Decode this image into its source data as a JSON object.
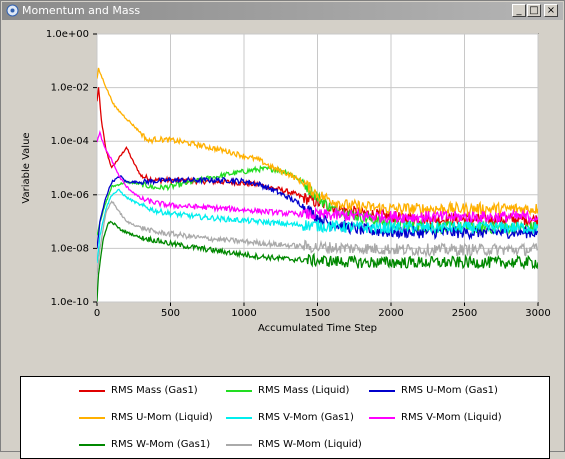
{
  "window": {
    "title": "Momentum and Mass",
    "minimize_glyph": "_",
    "maximize_glyph": "□",
    "close_glyph": "×",
    "icon": "app-gear-icon"
  },
  "chart_data": {
    "type": "line",
    "xlabel": "Accumulated Time Step",
    "ylabel": "Variable Value",
    "yscale": "log",
    "xlim": [
      0,
      3000
    ],
    "ylim": [
      1e-10,
      1
    ],
    "x_ticks": [
      0,
      500,
      1000,
      1500,
      2000,
      2500,
      3000
    ],
    "x_tick_labels": [
      "0",
      "500",
      "1000",
      "1500",
      "2000",
      "2500",
      "3000"
    ],
    "y_ticks": [
      1e-10,
      1e-08,
      1e-06,
      0.0001,
      0.01,
      1
    ],
    "y_tick_labels": [
      "1.0e-10",
      "1.0e-08",
      "1.0e-06",
      "1.0e-04",
      "1.0e-02",
      "1.0e+00"
    ],
    "grid": true,
    "legend_position": "bottom",
    "series": [
      {
        "name": "RMS Mass (Gas1)",
        "color": "#e00000",
        "x": [
          0,
          10,
          30,
          60,
          100,
          140,
          180,
          200,
          240,
          300,
          400,
          500,
          700,
          900,
          1100,
          1300,
          1500,
          1700,
          2000,
          2300,
          2600,
          3000
        ],
        "y": [
          0.003,
          0.01,
          0.0006,
          5e-05,
          1e-05,
          2e-05,
          4e-05,
          6e-05,
          2e-05,
          5e-06,
          3.5e-06,
          3.5e-06,
          3.2e-06,
          3e-06,
          2.4e-06,
          1.3e-06,
          5e-07,
          2.5e-07,
          1.5e-07,
          1.2e-07,
          1.2e-07,
          1.2e-07
        ]
      },
      {
        "name": "RMS Mass (Liquid)",
        "color": "#22dd22",
        "x": [
          0,
          20,
          60,
          100,
          200,
          300,
          400,
          500,
          700,
          900,
          1100,
          1200,
          1300,
          1400,
          1500,
          1600,
          1800,
          2000,
          2300,
          2600,
          3000
        ],
        "y": [
          3e-08,
          1e-07,
          5e-07,
          2e-06,
          3e-06,
          2.5e-06,
          1.8e-06,
          2e-06,
          3.5e-06,
          6e-06,
          9e-06,
          9e-06,
          7e-06,
          3e-06,
          8e-07,
          3e-07,
          1.5e-07,
          8e-08,
          6e-08,
          6e-08,
          6e-08
        ]
      },
      {
        "name": "RMS U-Mom (Gas1)",
        "color": "#0000cc",
        "x": [
          0,
          20,
          60,
          100,
          160,
          200,
          300,
          500,
          700,
          900,
          1000,
          1100,
          1200,
          1300,
          1400,
          1500,
          1600,
          1800,
          2000,
          2300,
          2600,
          3000
        ],
        "y": [
          1e-08,
          1e-07,
          8e-07,
          3e-06,
          5e-06,
          3e-06,
          3e-06,
          3.5e-06,
          3.5e-06,
          3.5e-06,
          3.2e-06,
          2.5e-06,
          1.5e-06,
          8e-07,
          4e-07,
          1.5e-07,
          8e-08,
          5e-08,
          4e-08,
          4e-08,
          4e-08,
          4e-08
        ]
      },
      {
        "name": "RMS U-Mom (Liquid)",
        "color": "#ffb000",
        "x": [
          0,
          10,
          40,
          80,
          120,
          200,
          300,
          350,
          400,
          500,
          600,
          700,
          900,
          1100,
          1200,
          1300,
          1400,
          1500,
          1700,
          2000,
          2300,
          2600,
          3000
        ],
        "y": [
          0.02,
          0.05,
          0.02,
          0.006,
          0.002,
          0.0007,
          0.0002,
          0.0001,
          0.00012,
          0.00011,
          9e-05,
          7e-05,
          4e-05,
          2e-05,
          1e-05,
          6e-06,
          3e-06,
          1e-06,
          4e-07,
          3e-07,
          3e-07,
          3e-07,
          3e-07
        ]
      },
      {
        "name": "RMS V-Mom (Gas1)",
        "color": "#00eeee",
        "x": [
          0,
          20,
          60,
          100,
          150,
          200,
          300,
          400,
          500,
          700,
          900,
          1100,
          1300,
          1500,
          1800,
          2100,
          2400,
          2700,
          3000
        ],
        "y": [
          3e-09,
          3e-08,
          3e-07,
          1e-06,
          1.5e-06,
          8e-07,
          4e-07,
          2.5e-07,
          2e-07,
          1.5e-07,
          1.2e-07,
          1e-07,
          8e-08,
          7e-08,
          6e-08,
          6e-08,
          6e-08,
          6e-08,
          6e-08
        ]
      },
      {
        "name": "RMS V-Mom (Liquid)",
        "color": "#ff00ff",
        "x": [
          0,
          20,
          50,
          100,
          150,
          200,
          300,
          400,
          500,
          700,
          900,
          1100,
          1300,
          1500,
          1800,
          2100,
          2400,
          2700,
          3000
        ],
        "y": [
          0.0001,
          0.0002,
          6e-05,
          2e-05,
          5e-06,
          2e-06,
          7e-07,
          5e-07,
          4e-07,
          3.5e-07,
          3e-07,
          2.5e-07,
          2e-07,
          1.8e-07,
          1.6e-07,
          1.5e-07,
          1.5e-07,
          1.5e-07,
          1.5e-07
        ]
      },
      {
        "name": "RMS W-Mom (Gas1)",
        "color": "#008800",
        "x": [
          0,
          10,
          40,
          80,
          120,
          160,
          200,
          300,
          400,
          500,
          700,
          900,
          1100,
          1300,
          1500,
          1800,
          2100,
          2400,
          2700,
          3000
        ],
        "y": [
          1e-10,
          1e-09,
          2e-08,
          1e-07,
          8e-08,
          5e-08,
          4e-08,
          2.5e-08,
          2e-08,
          1.5e-08,
          1e-08,
          7e-09,
          5e-09,
          4e-09,
          3.5e-09,
          3e-09,
          3e-09,
          3e-09,
          3e-09,
          3e-09
        ]
      },
      {
        "name": "RMS W-Mom (Liquid)",
        "color": "#aaaaaa",
        "x": [
          0,
          20,
          60,
          100,
          160,
          200,
          300,
          400,
          500,
          700,
          900,
          1100,
          1300,
          1500,
          1800,
          2100,
          2400,
          2700,
          3000
        ],
        "y": [
          1e-09,
          1e-08,
          2e-07,
          6e-07,
          2e-07,
          1e-07,
          6e-08,
          4e-08,
          3.5e-08,
          2.5e-08,
          2e-08,
          1.6e-08,
          1.3e-08,
          1.1e-08,
          1e-08,
          9e-09,
          9e-09,
          9e-09,
          9e-09
        ]
      }
    ]
  }
}
